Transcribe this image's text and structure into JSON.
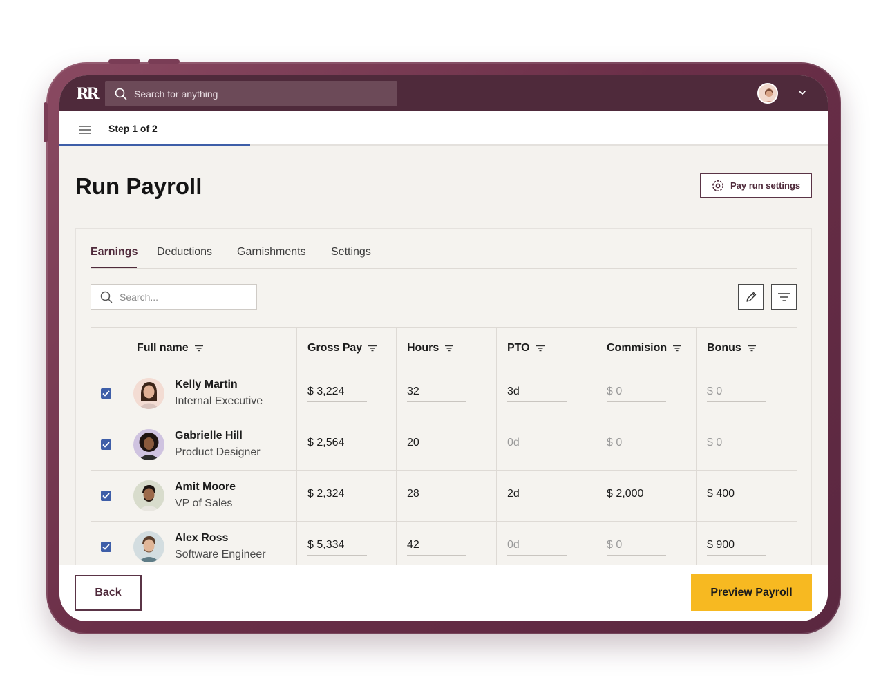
{
  "app": {
    "logo": "RR"
  },
  "topbar": {
    "search_placeholder": "Search for anything"
  },
  "stepbar": {
    "step_label": "Step 1 of 2",
    "progress": 0.25
  },
  "header": {
    "title": "Run Payroll",
    "settings_label": "Pay run settings"
  },
  "tabs": [
    {
      "label": "Earnings",
      "active": true
    },
    {
      "label": "Deductions",
      "active": false
    },
    {
      "label": "Garnishments",
      "active": false
    },
    {
      "label": "Settings",
      "active": false
    }
  ],
  "table_search": {
    "placeholder": "Search..."
  },
  "columns": {
    "full_name": "Full name",
    "gross_pay": "Gross Pay",
    "hours": "Hours",
    "pto": "PTO",
    "commission": "Commision",
    "bonus": "Bonus"
  },
  "rows": [
    {
      "name": "Kelly Martin",
      "role": "Internal Executive",
      "checked": true,
      "gross_pay": "$ 3,224",
      "hours": "32",
      "pto": "3d",
      "commission": "$ 0",
      "bonus": "$ 0"
    },
    {
      "name": "Gabrielle Hill",
      "role": "Product Designer",
      "checked": true,
      "gross_pay": "$ 2,564",
      "hours": "20",
      "pto": "0d",
      "commission": "$ 0",
      "bonus": "$ 0"
    },
    {
      "name": "Amit Moore",
      "role": "VP of Sales",
      "checked": true,
      "gross_pay": "$ 2,324",
      "hours": "28",
      "pto": "2d",
      "commission": "$ 2,000",
      "bonus": "$ 400"
    },
    {
      "name": "Alex Ross",
      "role": "Software Engineer",
      "checked": true,
      "gross_pay": "$ 5,334",
      "hours": "42",
      "pto": "0d",
      "commission": "$ 0",
      "bonus": "$ 900"
    }
  ],
  "footer": {
    "back_label": "Back",
    "preview_label": "Preview Payroll"
  },
  "colors": {
    "brand": "#4f2a3b",
    "accent": "#f7b921",
    "progress": "#3e5ea8",
    "frame": "#6b2f48"
  }
}
